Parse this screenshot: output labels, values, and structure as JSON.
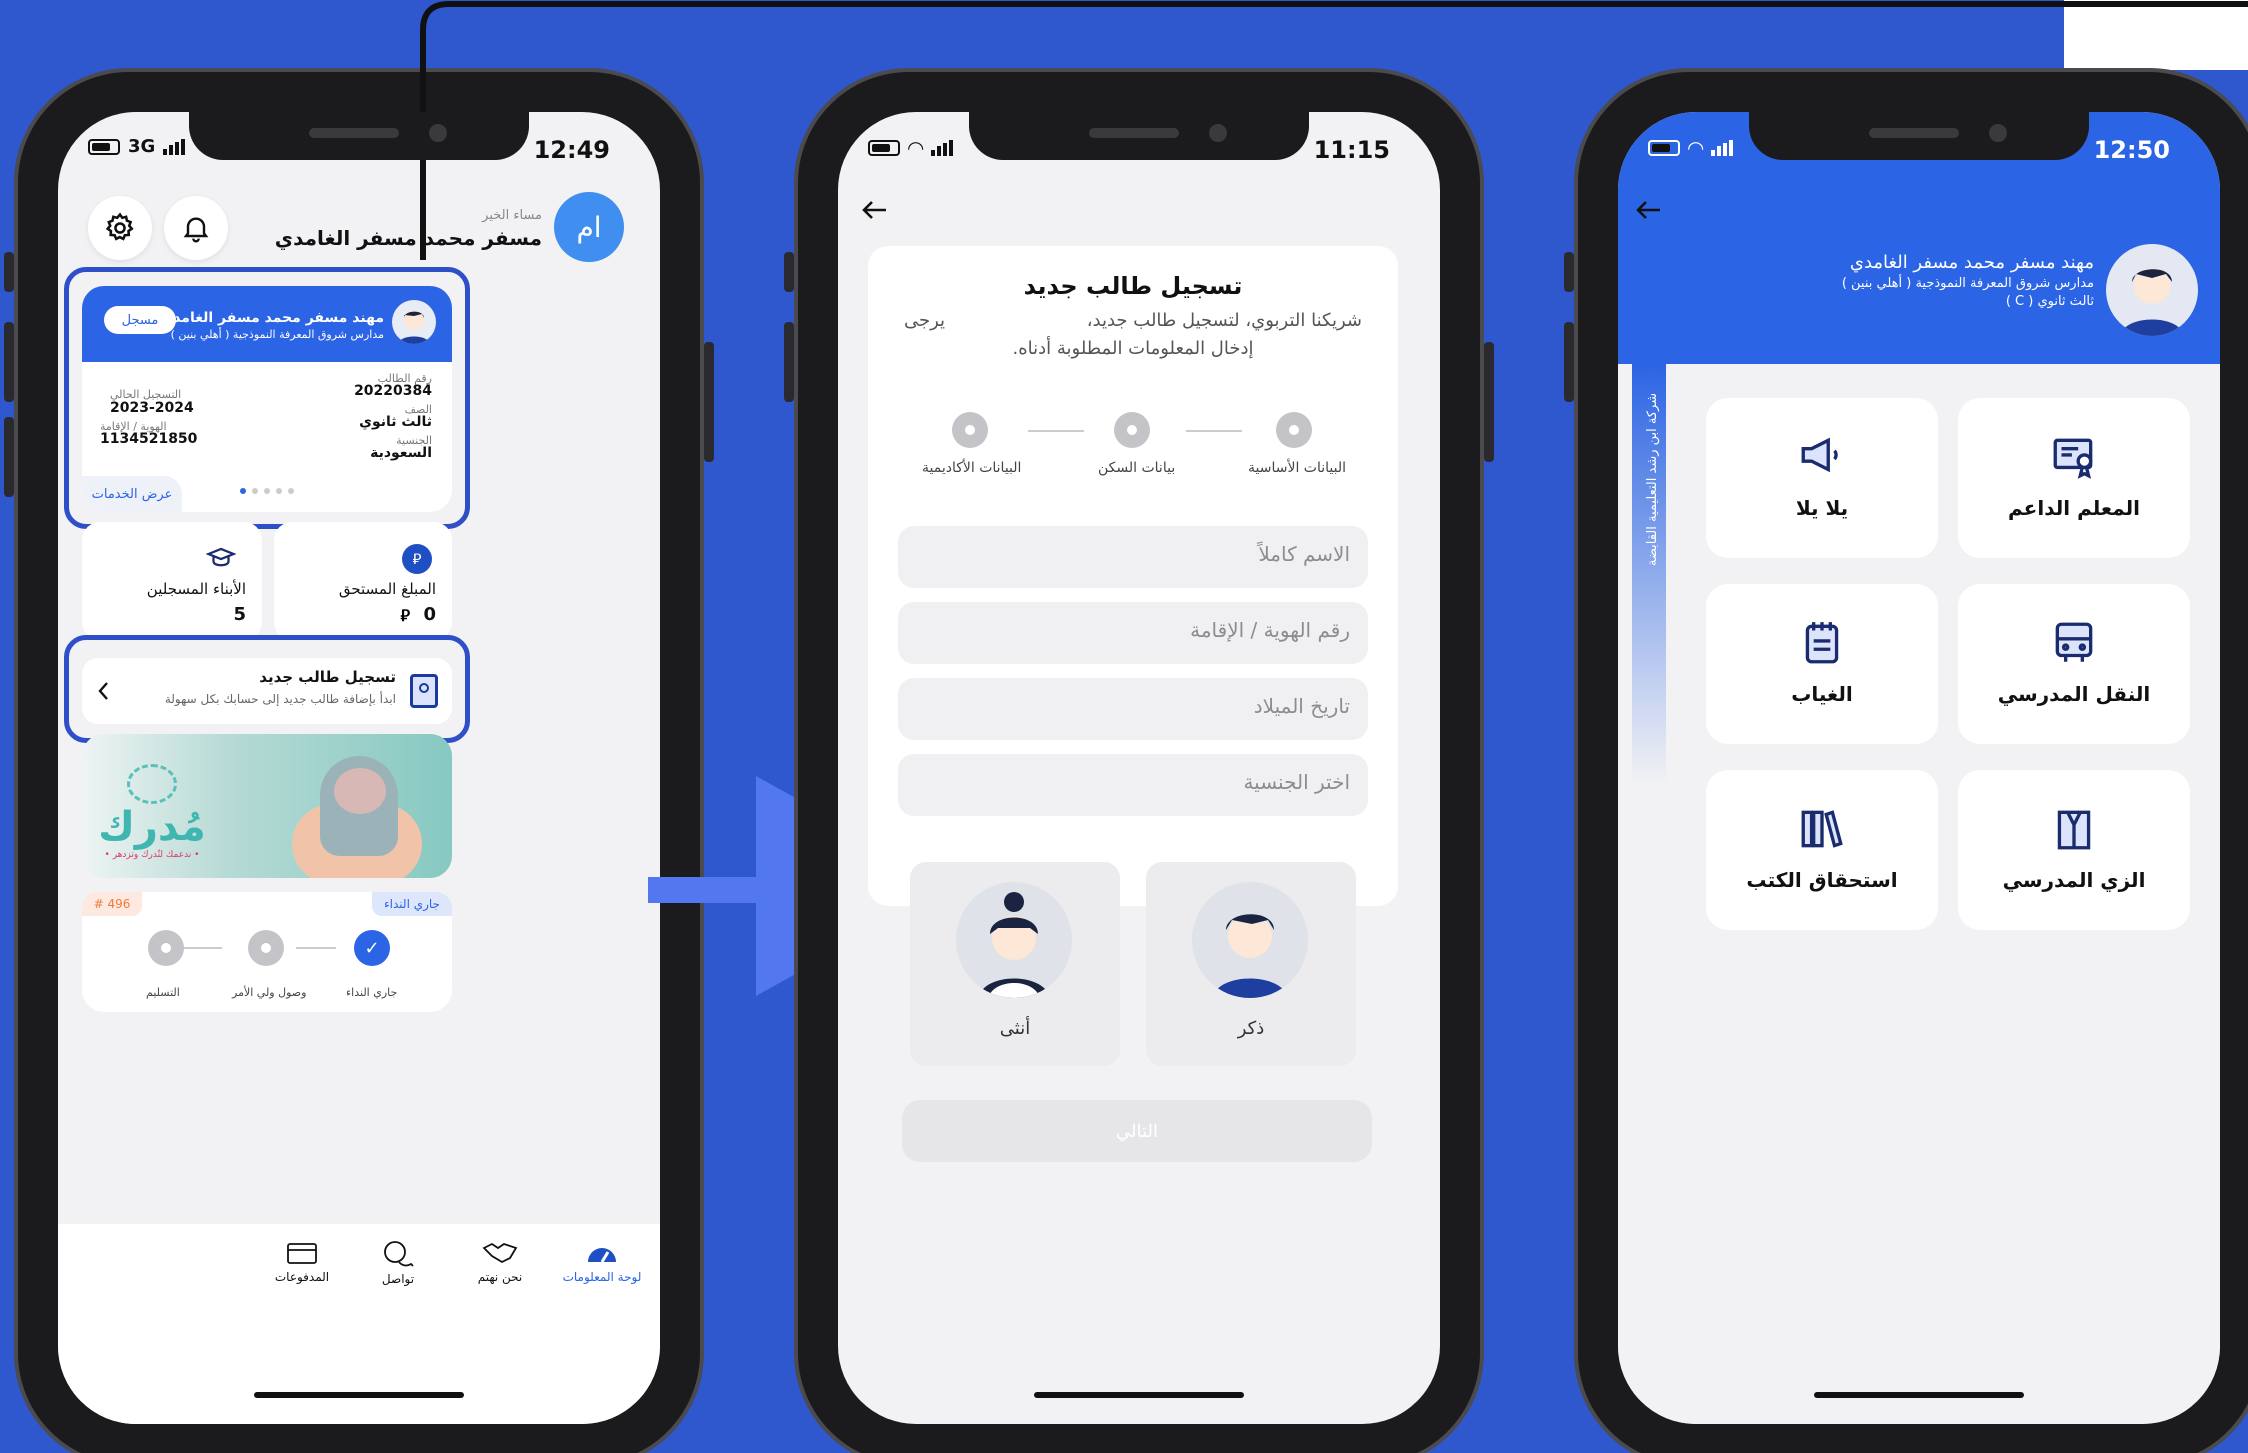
{
  "colors": {
    "background": "#2f58cf",
    "brand_blue": "#2b64e4",
    "outline": "#2e4fc7",
    "arrow": "#5277ef"
  },
  "phone1": {
    "status": {
      "network": "3G",
      "time": "12:49"
    },
    "header": {
      "greeting": "مساء الخير",
      "user_name": "مسفر محمد مسفر الغامدي",
      "avatar_initials": "ام"
    },
    "student_card": {
      "name": "مهند مسفر محمد مسفر الغامدي",
      "school": "مدارس شروق المعرفة النموذجية ( أهلي بنين )",
      "badge": "مسجل",
      "fields": [
        {
          "label": "رقم الطالب",
          "value": "20220384"
        },
        {
          "label": "الصف",
          "value": "ثالث ثانوي"
        },
        {
          "label": "الجنسية",
          "value": "السعودية"
        },
        {
          "label": "التسجيل الحالي",
          "value": "2023-2024"
        },
        {
          "label": "الهوية / الإقامة",
          "value": "1134521850"
        }
      ],
      "services_link": "عرض الخدمات"
    },
    "stats": [
      {
        "label": "المبلغ المستحق",
        "value": "0",
        "icon": "riyal-icon"
      },
      {
        "label": "الأبناء المسجلين",
        "value": "5",
        "icon": "graduate-icon"
      }
    ],
    "register": {
      "title": "تسجيل طالب جديد",
      "subtitle": "ابدأ بإضافة طالب جديد إلى حسابك بكل سهولة"
    },
    "banner": {
      "brand": "مُدرك",
      "tagline": "• ندعمك لتُدرك وتزدهر •"
    },
    "ticket": {
      "number": "# 496",
      "status": "جاري النداء",
      "steps": [
        "جاري النداء",
        "وصول ولي الأمر",
        "التسليم"
      ]
    },
    "nav": [
      "لوحة المعلومات",
      "نحن نهتم",
      "تواصل",
      "المدفوعات"
    ]
  },
  "phone2": {
    "status": {
      "time": "11:15"
    },
    "title": "تسجيل طالب جديد",
    "desc_line1": "شريكنا التربوي، لتسجيل طالب جديد،",
    "desc_word": "يرجى",
    "desc_line2": "إدخال المعلومات المطلوبة أدناه.",
    "steps": [
      "البيانات الأساسية",
      "بيانات السكن",
      "البيانات الأكاديمية"
    ],
    "fields": [
      "الاسم كاملاً",
      "رقم الهوية / الإقامة",
      "تاريخ الميلاد",
      "اختر الجنسية"
    ],
    "genders": [
      "ذكر",
      "أنثى"
    ],
    "next": "التالي"
  },
  "phone3": {
    "status": {
      "time": "12:50"
    },
    "student": {
      "name": "مهند مسفر محمد مسفر الغامدي",
      "school": "مدارس شروق المعرفة النموذجية ( أهلي بنين )",
      "grade": "ثالث ثانوي ( C )"
    },
    "side_text": "شركة ابن رشد التعليمية القابضة",
    "tiles": [
      {
        "label": "المعلم الداعم",
        "icon": "certificate-icon"
      },
      {
        "label": "يلا يلا",
        "icon": "megaphone-icon"
      },
      {
        "label": "النقل المدرسي",
        "icon": "bus-icon"
      },
      {
        "label": "الغياب",
        "icon": "notepad-icon"
      },
      {
        "label": "الزي المدرسي",
        "icon": "uniform-icon"
      },
      {
        "label": "استحقاق الكتب",
        "icon": "books-icon"
      }
    ]
  }
}
